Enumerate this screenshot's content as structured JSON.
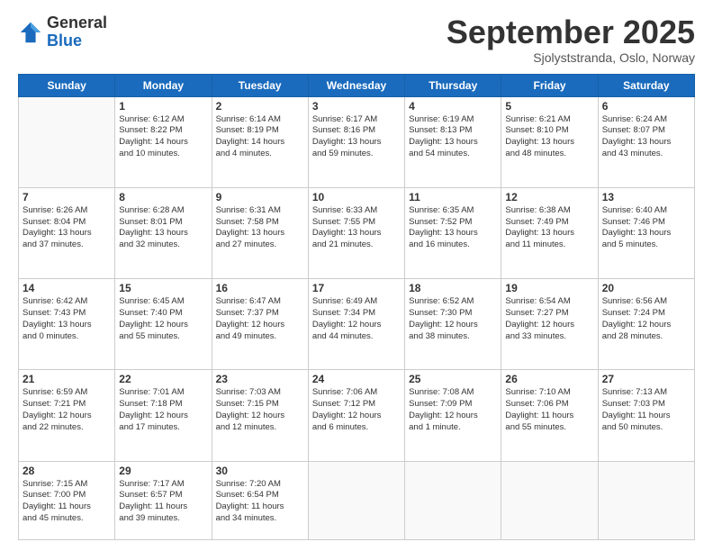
{
  "logo": {
    "general": "General",
    "blue": "Blue"
  },
  "header": {
    "month": "September 2025",
    "location": "Sjolyststranda, Oslo, Norway"
  },
  "weekdays": [
    "Sunday",
    "Monday",
    "Tuesday",
    "Wednesday",
    "Thursday",
    "Friday",
    "Saturday"
  ],
  "weeks": [
    [
      {
        "day": "",
        "info": ""
      },
      {
        "day": "1",
        "info": "Sunrise: 6:12 AM\nSunset: 8:22 PM\nDaylight: 14 hours\nand 10 minutes."
      },
      {
        "day": "2",
        "info": "Sunrise: 6:14 AM\nSunset: 8:19 PM\nDaylight: 14 hours\nand 4 minutes."
      },
      {
        "day": "3",
        "info": "Sunrise: 6:17 AM\nSunset: 8:16 PM\nDaylight: 13 hours\nand 59 minutes."
      },
      {
        "day": "4",
        "info": "Sunrise: 6:19 AM\nSunset: 8:13 PM\nDaylight: 13 hours\nand 54 minutes."
      },
      {
        "day": "5",
        "info": "Sunrise: 6:21 AM\nSunset: 8:10 PM\nDaylight: 13 hours\nand 48 minutes."
      },
      {
        "day": "6",
        "info": "Sunrise: 6:24 AM\nSunset: 8:07 PM\nDaylight: 13 hours\nand 43 minutes."
      }
    ],
    [
      {
        "day": "7",
        "info": "Sunrise: 6:26 AM\nSunset: 8:04 PM\nDaylight: 13 hours\nand 37 minutes."
      },
      {
        "day": "8",
        "info": "Sunrise: 6:28 AM\nSunset: 8:01 PM\nDaylight: 13 hours\nand 32 minutes."
      },
      {
        "day": "9",
        "info": "Sunrise: 6:31 AM\nSunset: 7:58 PM\nDaylight: 13 hours\nand 27 minutes."
      },
      {
        "day": "10",
        "info": "Sunrise: 6:33 AM\nSunset: 7:55 PM\nDaylight: 13 hours\nand 21 minutes."
      },
      {
        "day": "11",
        "info": "Sunrise: 6:35 AM\nSunset: 7:52 PM\nDaylight: 13 hours\nand 16 minutes."
      },
      {
        "day": "12",
        "info": "Sunrise: 6:38 AM\nSunset: 7:49 PM\nDaylight: 13 hours\nand 11 minutes."
      },
      {
        "day": "13",
        "info": "Sunrise: 6:40 AM\nSunset: 7:46 PM\nDaylight: 13 hours\nand 5 minutes."
      }
    ],
    [
      {
        "day": "14",
        "info": "Sunrise: 6:42 AM\nSunset: 7:43 PM\nDaylight: 13 hours\nand 0 minutes."
      },
      {
        "day": "15",
        "info": "Sunrise: 6:45 AM\nSunset: 7:40 PM\nDaylight: 12 hours\nand 55 minutes."
      },
      {
        "day": "16",
        "info": "Sunrise: 6:47 AM\nSunset: 7:37 PM\nDaylight: 12 hours\nand 49 minutes."
      },
      {
        "day": "17",
        "info": "Sunrise: 6:49 AM\nSunset: 7:34 PM\nDaylight: 12 hours\nand 44 minutes."
      },
      {
        "day": "18",
        "info": "Sunrise: 6:52 AM\nSunset: 7:30 PM\nDaylight: 12 hours\nand 38 minutes."
      },
      {
        "day": "19",
        "info": "Sunrise: 6:54 AM\nSunset: 7:27 PM\nDaylight: 12 hours\nand 33 minutes."
      },
      {
        "day": "20",
        "info": "Sunrise: 6:56 AM\nSunset: 7:24 PM\nDaylight: 12 hours\nand 28 minutes."
      }
    ],
    [
      {
        "day": "21",
        "info": "Sunrise: 6:59 AM\nSunset: 7:21 PM\nDaylight: 12 hours\nand 22 minutes."
      },
      {
        "day": "22",
        "info": "Sunrise: 7:01 AM\nSunset: 7:18 PM\nDaylight: 12 hours\nand 17 minutes."
      },
      {
        "day": "23",
        "info": "Sunrise: 7:03 AM\nSunset: 7:15 PM\nDaylight: 12 hours\nand 12 minutes."
      },
      {
        "day": "24",
        "info": "Sunrise: 7:06 AM\nSunset: 7:12 PM\nDaylight: 12 hours\nand 6 minutes."
      },
      {
        "day": "25",
        "info": "Sunrise: 7:08 AM\nSunset: 7:09 PM\nDaylight: 12 hours\nand 1 minute."
      },
      {
        "day": "26",
        "info": "Sunrise: 7:10 AM\nSunset: 7:06 PM\nDaylight: 11 hours\nand 55 minutes."
      },
      {
        "day": "27",
        "info": "Sunrise: 7:13 AM\nSunset: 7:03 PM\nDaylight: 11 hours\nand 50 minutes."
      }
    ],
    [
      {
        "day": "28",
        "info": "Sunrise: 7:15 AM\nSunset: 7:00 PM\nDaylight: 11 hours\nand 45 minutes."
      },
      {
        "day": "29",
        "info": "Sunrise: 7:17 AM\nSunset: 6:57 PM\nDaylight: 11 hours\nand 39 minutes."
      },
      {
        "day": "30",
        "info": "Sunrise: 7:20 AM\nSunset: 6:54 PM\nDaylight: 11 hours\nand 34 minutes."
      },
      {
        "day": "",
        "info": ""
      },
      {
        "day": "",
        "info": ""
      },
      {
        "day": "",
        "info": ""
      },
      {
        "day": "",
        "info": ""
      }
    ]
  ]
}
